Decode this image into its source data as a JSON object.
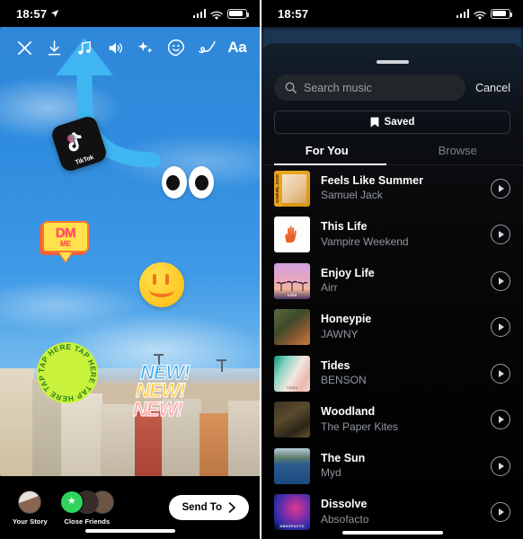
{
  "left": {
    "status": {
      "time": "18:57",
      "location_icon": "location-arrow-icon"
    },
    "toolbar": [
      {
        "name": "close-icon",
        "label": "Close"
      },
      {
        "name": "download-icon",
        "label": "Save"
      },
      {
        "name": "music-note-icon",
        "label": "Music"
      },
      {
        "name": "volume-icon",
        "label": "Sound"
      },
      {
        "name": "sparkles-icon",
        "label": "Effects"
      },
      {
        "name": "sticker-icon",
        "label": "Stickers"
      },
      {
        "name": "draw-icon",
        "label": "Draw"
      },
      {
        "name": "text-icon",
        "label": "Aa"
      }
    ],
    "stickers": {
      "tiktok_label": "TikTok",
      "dm_line1": "DM",
      "dm_line2": "ME",
      "tap_here": "TAP HERE TAP HERE TAP HERE TAP HERE ",
      "new_1": "NEW!",
      "new_2": "NEW!",
      "new_3": "NEW!"
    },
    "bottom": {
      "your_story": "Your Story",
      "close_friends": "Close Friends",
      "send_to": "Send To",
      "chevron": "chevron-right-icon"
    }
  },
  "right": {
    "status": {
      "time": "18:57"
    },
    "search": {
      "placeholder": "Search music",
      "icon": "search-icon"
    },
    "cancel_label": "Cancel",
    "saved_label": "Saved",
    "saved_icon": "bookmark-icon",
    "tabs": [
      {
        "label": "For You",
        "active": true
      },
      {
        "label": "Browse",
        "active": false
      }
    ],
    "tracks": [
      {
        "title": "Feels Like Summer",
        "artist": "Samuel Jack",
        "art": "a-feels",
        "art_caption": "SAMUEL JACK"
      },
      {
        "title": "This Life",
        "artist": "Vampire Weekend",
        "art": "a-this",
        "art_caption": ""
      },
      {
        "title": "Enjoy Life",
        "artist": "Airr",
        "art": "a-enjoy",
        "art_caption": "AIRR"
      },
      {
        "title": "Honeypie",
        "artist": "JAWNY",
        "art": "a-honey",
        "art_caption": ""
      },
      {
        "title": "Tides",
        "artist": "BENSON",
        "art": "a-tides",
        "art_caption": "TIDES"
      },
      {
        "title": "Woodland",
        "artist": "The Paper Kites",
        "art": "a-wood",
        "art_caption": ""
      },
      {
        "title": "The Sun",
        "artist": "Myd",
        "art": "a-sun",
        "art_caption": ""
      },
      {
        "title": "Dissolve",
        "artist": "Absofacto",
        "art": "a-diss",
        "art_caption": "ABSOFACTO"
      }
    ],
    "play_icon": "play-button-icon"
  },
  "colors": {
    "accent_blue": "#35a9f0",
    "sticker_yellow": "#ffe24d",
    "sticker_pink": "#ff3d9b",
    "tap_green": "#c9f23c",
    "close_friends_green": "#2fd45e",
    "sheet_bg": "#0a0a0c"
  }
}
